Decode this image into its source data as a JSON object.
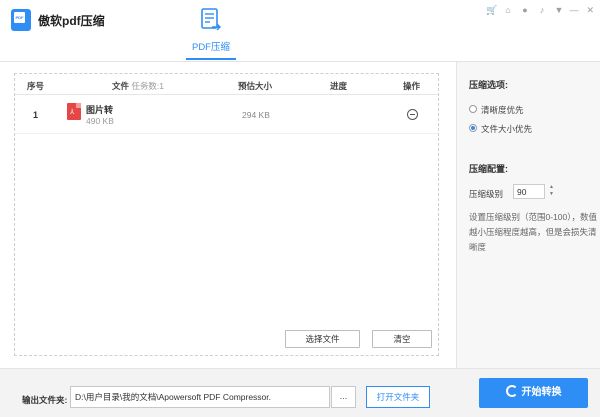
{
  "app": {
    "title": "傲软pdf压缩",
    "logo_text": "PDF"
  },
  "tabs": [
    {
      "label": "PDF压缩",
      "icon": "pdf-compress-icon",
      "active": true
    }
  ],
  "window_icons": [
    "cart-icon",
    "home-icon",
    "user-icon",
    "notification-icon",
    "dropdown-icon"
  ],
  "window_controls": [
    "minimize-icon",
    "close-icon"
  ],
  "table": {
    "headers": {
      "index": "序号",
      "file": "文件",
      "task_count": "任务数:1",
      "estimated_size": "预估大小",
      "progress": "进度",
      "action": "操作"
    },
    "rows": [
      {
        "index": "1",
        "name": "图片转",
        "size": "490 KB",
        "estimated": "294 KB",
        "progress": ""
      }
    ]
  },
  "file_actions": {
    "select_files": "选择文件",
    "clear": "清空"
  },
  "options": {
    "title": "压缩选项:",
    "radio_1": "清晰度优先",
    "radio_2": "文件大小优先",
    "selected": "文件大小优先"
  },
  "config": {
    "title": "压缩配置:",
    "level_label": "压缩级别",
    "level_value": "90",
    "description": "设置压缩级别（范围0-100），数值越小压缩程度越高，但是会损失清晰度"
  },
  "output": {
    "label": "输出文件夹:",
    "path": "D:\\用户目录\\我的文档\\Apowersoft PDF Compressor.",
    "browse": "...",
    "open_folder": "打开文件夹"
  },
  "start_button": "开始转换",
  "colors": {
    "accent": "#2f8df6",
    "pdf_red": "#e54646"
  }
}
